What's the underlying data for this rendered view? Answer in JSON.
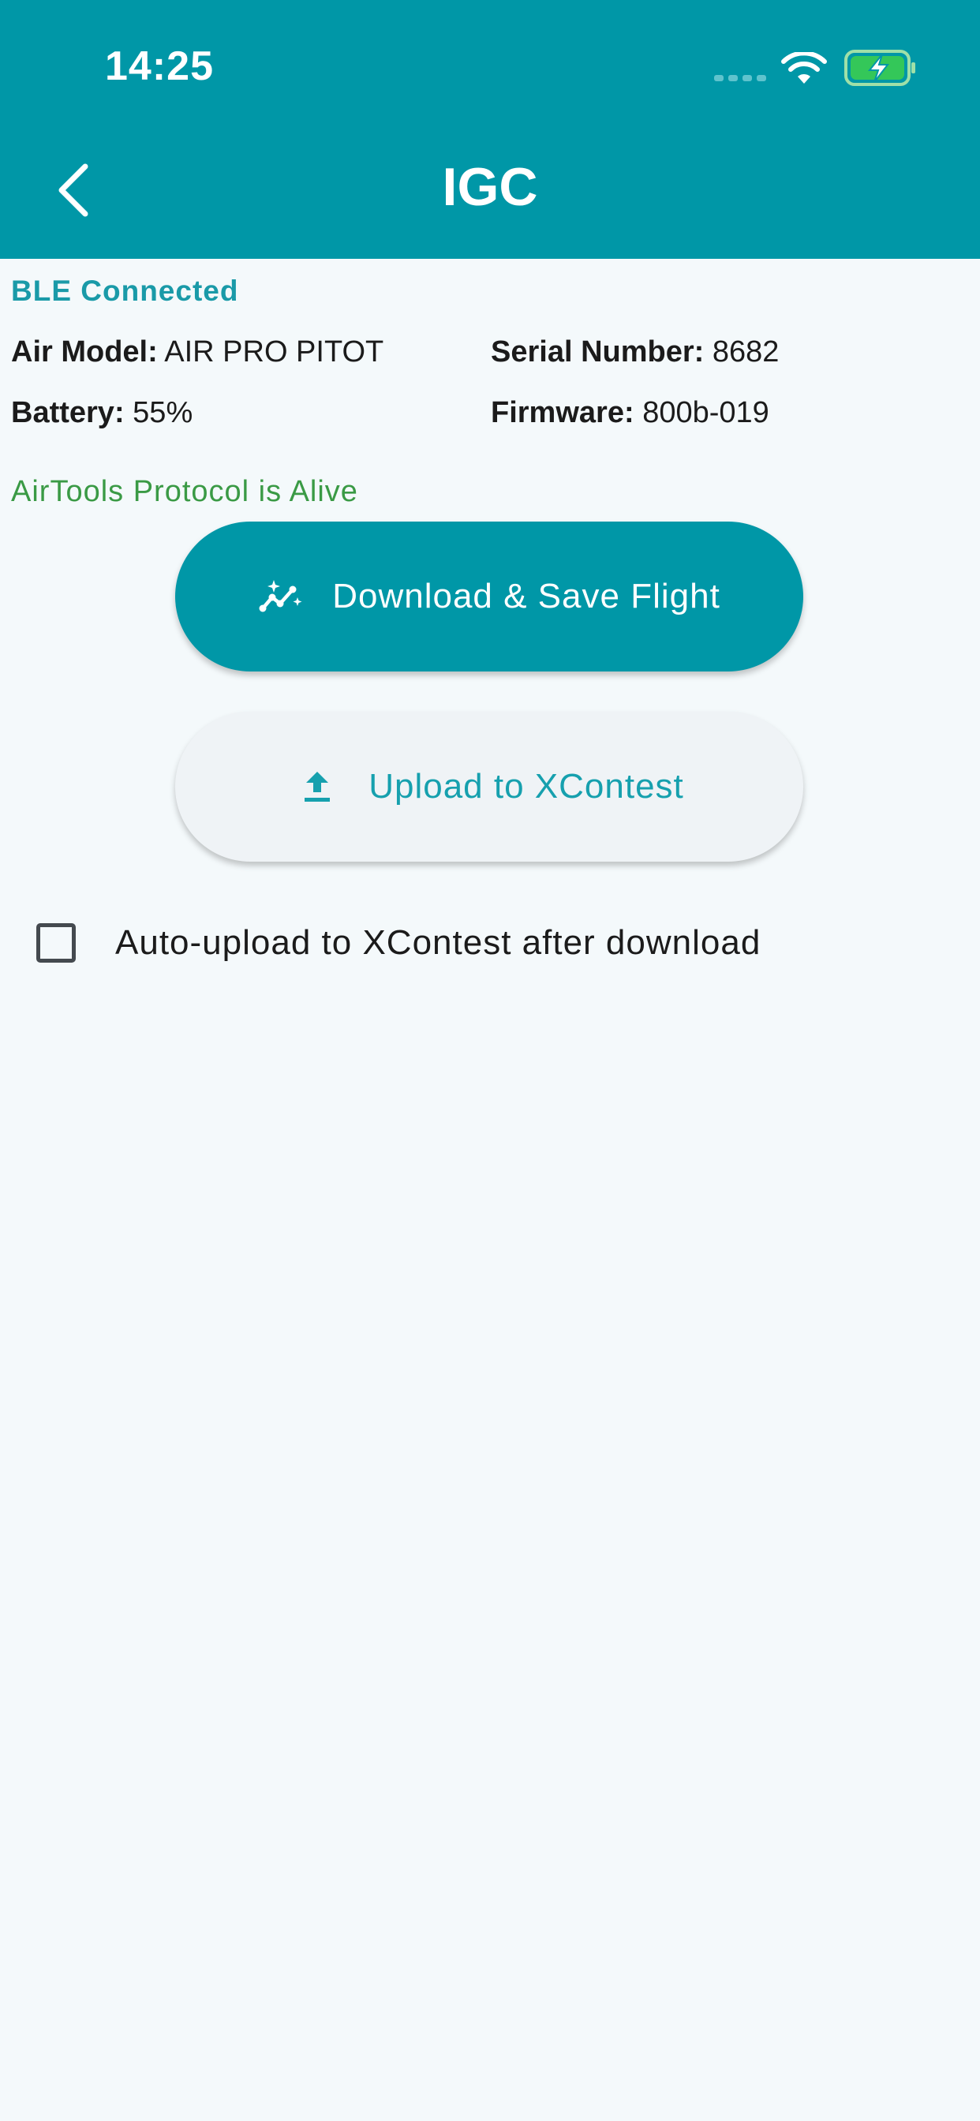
{
  "status_bar": {
    "time": "14:25",
    "icons": [
      "signal-dots-icon",
      "wifi-icon",
      "battery-charging-icon"
    ],
    "battery_color": "#34c759"
  },
  "header": {
    "title": "IGC",
    "back_icon": "chevron-left-icon",
    "background_color": "#0097a7"
  },
  "device": {
    "connection_status": "BLE Connected",
    "air_model_label": "Air Model:",
    "air_model_value": "AIR PRO PITOT",
    "serial_label": "Serial Number:",
    "serial_value": "8682",
    "battery_label": "Battery:",
    "battery_value": "55%",
    "firmware_label": "Firmware:",
    "firmware_value": "800b-019",
    "protocol_status": "AirTools Protocol is Alive"
  },
  "actions": {
    "download_label": "Download & Save Flight",
    "download_icon": "sparkle-chart-icon",
    "upload_label": "Upload to XContest",
    "upload_icon": "upload-icon"
  },
  "options": {
    "auto_upload_label": "Auto-upload to XContest after download",
    "auto_upload_checked": false
  },
  "colors": {
    "accent": "#0097a7",
    "status_text": "#1a9aa8",
    "protocol_alive": "#3a9a45",
    "background": "#f4f9fb"
  }
}
